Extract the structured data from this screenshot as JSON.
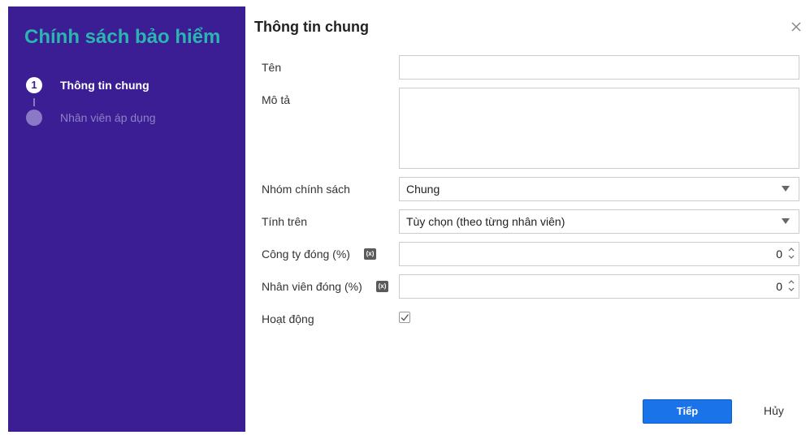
{
  "sidebar": {
    "title": "Chính sách bảo hiểm",
    "steps": [
      {
        "number": "1",
        "label": "Thông tin chung"
      },
      {
        "number": "",
        "label": "Nhân viên áp dụng"
      }
    ]
  },
  "dialog": {
    "title": "Thông tin chung",
    "close_icon": "close-icon"
  },
  "form": {
    "name_label": "Tên",
    "name_value": "",
    "desc_label": "Mô tả",
    "desc_value": "",
    "group_label": "Nhóm chính sách",
    "group_value": "Chung",
    "calc_label": "Tính trên",
    "calc_value": "Tùy chọn (theo từng nhân viên)",
    "company_label": "Công ty đóng (%)",
    "company_value": "0",
    "employee_label": "Nhân viên đóng (%)",
    "employee_value": "0",
    "formula_badge": "(x)",
    "active_label": "Hoạt động",
    "active_checked": true
  },
  "footer": {
    "next_label": "Tiếp",
    "cancel_label": "Hủy"
  },
  "colors": {
    "sidebar_bg": "#3b1e93",
    "title_accent": "#2bb5b1",
    "primary": "#1a73e8"
  }
}
